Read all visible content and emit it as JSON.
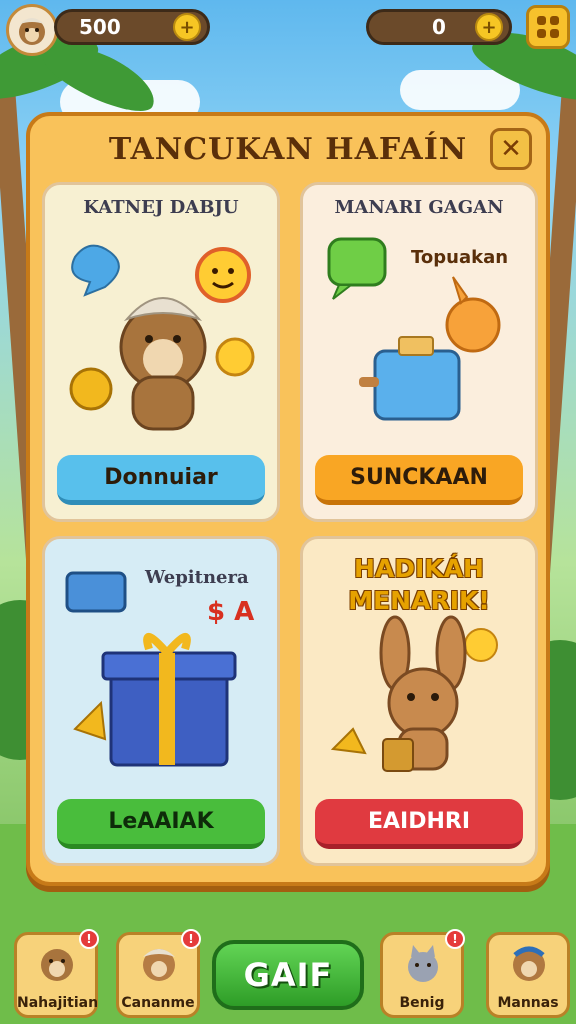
{
  "topbar": {
    "currency_left": "500",
    "currency_right": "0",
    "icons": [
      "avatar-icon",
      "plus-icon",
      "coin-icon",
      "plus-icon",
      "grid-menu-icon"
    ]
  },
  "panel": {
    "title": "TANCUKAN HAFAÍN",
    "close_icon": "close-icon"
  },
  "cards": [
    {
      "title": "KATNEJ DABJU",
      "button": "Donnuiar",
      "color": "#58c0ec"
    },
    {
      "title": "MANARI GAGAN",
      "side_text": "Topuakan",
      "button": "SUNCKAAN",
      "color": "#f9a624"
    },
    {
      "title": "Wepitnera",
      "side_text": "$ A",
      "button": "LeAAIAK",
      "color": "#49bd3c"
    },
    {
      "title": "HADIKÁH MENARIK!",
      "button": "EAIDHRI",
      "color": "#e03a40"
    }
  ],
  "bottom_nav": {
    "items": [
      {
        "label": "Nahajitian"
      },
      {
        "label": "Cananme"
      },
      {
        "label": "Benig"
      },
      {
        "label": "Mannas"
      }
    ],
    "center_button": "GAIF"
  }
}
